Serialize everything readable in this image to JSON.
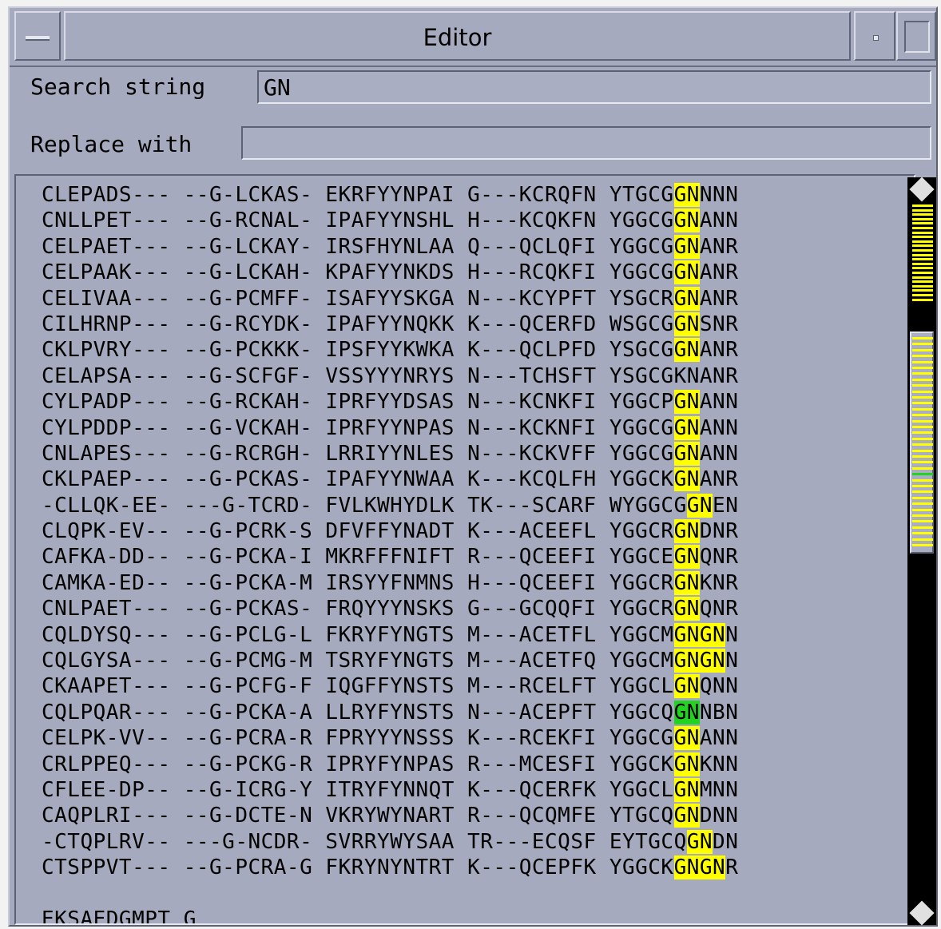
{
  "window": {
    "title": "Editor"
  },
  "search": {
    "label": "Search string",
    "value": "GN"
  },
  "replace": {
    "label": "Replace with",
    "value": ""
  },
  "highlight_colors": {
    "match": "#ffff00",
    "current_match": "#22d322"
  },
  "sequences": [
    {
      "cols": [
        "CLEPADS---",
        "--G-LCKAS-",
        "EKRFYYNPAI",
        "G---KCRQFN"
      ],
      "last": [
        {
          "t": "YTGCG"
        },
        {
          "t": "GN",
          "h": "m"
        },
        {
          "t": "NNN"
        }
      ]
    },
    {
      "cols": [
        "CNLLPET---",
        "--G-RCNAL-",
        "IPAFYYNSHL",
        "H---KCQKFN"
      ],
      "last": [
        {
          "t": "YGGCG"
        },
        {
          "t": "GN",
          "h": "m"
        },
        {
          "t": "ANN"
        }
      ]
    },
    {
      "cols": [
        "CELPAET---",
        "--G-LCKAY-",
        "IRSFHYNLAA",
        "Q---QCLQFI"
      ],
      "last": [
        {
          "t": "YGGCG"
        },
        {
          "t": "GN",
          "h": "m"
        },
        {
          "t": "ANR"
        }
      ]
    },
    {
      "cols": [
        "CELPAAK---",
        "--G-LCKAH-",
        "KPAFYYNKDS",
        "H---RCQKFI"
      ],
      "last": [
        {
          "t": "YGGCG"
        },
        {
          "t": "GN",
          "h": "m"
        },
        {
          "t": "ANR"
        }
      ]
    },
    {
      "cols": [
        "CELIVAA---",
        "--G-PCMFF-",
        "ISAFYYSKGA",
        "N---KCYPFT"
      ],
      "last": [
        {
          "t": "YSGCR"
        },
        {
          "t": "GN",
          "h": "m"
        },
        {
          "t": "ANR"
        }
      ]
    },
    {
      "cols": [
        "CILHRNP---",
        "--G-RCYDK-",
        "IPAFYYNQKK",
        "K---QCERFD"
      ],
      "last": [
        {
          "t": "WSGCG"
        },
        {
          "t": "GN",
          "h": "m"
        },
        {
          "t": "SNR"
        }
      ]
    },
    {
      "cols": [
        "CKLPVRY---",
        "--G-PCKKK-",
        "IPSFYYKWKA",
        "K---QCLPFD"
      ],
      "last": [
        {
          "t": "YSGCG"
        },
        {
          "t": "GN",
          "h": "m"
        },
        {
          "t": "ANR"
        }
      ]
    },
    {
      "cols": [
        "CELAPSA---",
        "--G-SCFGF-",
        "VSSYYYNRYS",
        "N---TCHSFT"
      ],
      "last": [
        {
          "t": "YSGCGKNANR"
        }
      ]
    },
    {
      "cols": [
        "CYLPADP---",
        "--G-RCKAH-",
        "IPRFYYDSAS",
        "N---KCNKFI"
      ],
      "last": [
        {
          "t": "YGGCP"
        },
        {
          "t": "GN",
          "h": "m"
        },
        {
          "t": "ANN"
        }
      ]
    },
    {
      "cols": [
        "CYLPDDP---",
        "--G-VCKAH-",
        "IPRFYYNPAS",
        "N---KCKNFI"
      ],
      "last": [
        {
          "t": "YGGCG"
        },
        {
          "t": "GN",
          "h": "m"
        },
        {
          "t": "ANN"
        }
      ]
    },
    {
      "cols": [
        "CNLAPES---",
        "--G-RCRGH-",
        "LRRIYYNLES",
        "N---KCKVFF"
      ],
      "last": [
        {
          "t": "YGGCG"
        },
        {
          "t": "GN",
          "h": "m"
        },
        {
          "t": "ANN"
        }
      ]
    },
    {
      "cols": [
        "CKLPAEP---",
        "--G-PCKAS-",
        "IPAFYYNWAA",
        "K---KCQLFH"
      ],
      "last": [
        {
          "t": "YGGCK"
        },
        {
          "t": "GN",
          "h": "m"
        },
        {
          "t": "ANR"
        }
      ]
    },
    {
      "cols": [
        "-CLLQK-EE-",
        "---G-TCRD-",
        "FVLKWHYDLK",
        "TK---SCARF"
      ],
      "last": [
        {
          "t": "WYGGCG"
        },
        {
          "t": "GN",
          "h": "m"
        },
        {
          "t": "EN"
        }
      ]
    },
    {
      "cols": [
        "CLQPK-EV--",
        "--G-PCRK-S",
        "DFVFFYNADT",
        "K---ACEEFL"
      ],
      "last": [
        {
          "t": "YGGCR"
        },
        {
          "t": "GN",
          "h": "m"
        },
        {
          "t": "DNR"
        }
      ]
    },
    {
      "cols": [
        "CAFKA-DD--",
        "--G-PCKA-I",
        "MKRFFFNIFT",
        "R---QCEEFI"
      ],
      "last": [
        {
          "t": "YGGCE"
        },
        {
          "t": "GN",
          "h": "m"
        },
        {
          "t": "QNR"
        }
      ]
    },
    {
      "cols": [
        "CAMKA-ED--",
        "--G-PCKA-M",
        "IRSYYFNMNS",
        "H---QCEEFI"
      ],
      "last": [
        {
          "t": "YGGCR"
        },
        {
          "t": "GN",
          "h": "m"
        },
        {
          "t": "KNR"
        }
      ]
    },
    {
      "cols": [
        "CNLPAET---",
        "--G-PCKAS-",
        "FRQYYYNSKS",
        "G---GCQQFI"
      ],
      "last": [
        {
          "t": "YGGCR"
        },
        {
          "t": "GN",
          "h": "m"
        },
        {
          "t": "QNR"
        }
      ]
    },
    {
      "cols": [
        "CQLDYSQ---",
        "--G-PCLG-L",
        "FKRYFYNGTS",
        "M---ACETFL"
      ],
      "last": [
        {
          "t": "YGGCM"
        },
        {
          "t": "GNGN",
          "h": "m"
        },
        {
          "t": "N"
        }
      ]
    },
    {
      "cols": [
        "CQLGYSA---",
        "--G-PCMG-M",
        "TSRYFYNGTS",
        "M---ACETFQ"
      ],
      "last": [
        {
          "t": "YGGCM"
        },
        {
          "t": "GNGN",
          "h": "m"
        },
        {
          "t": "N"
        }
      ]
    },
    {
      "cols": [
        "CKAAPET---",
        "--G-PCFG-F",
        "IQGFFYNSTS",
        "M---RCELFT"
      ],
      "last": [
        {
          "t": "YGGCL"
        },
        {
          "t": "GN",
          "h": "m"
        },
        {
          "t": "QNN"
        }
      ]
    },
    {
      "cols": [
        "CQLPQAR---",
        "--G-PCKA-A",
        "LLRYFYNSTS",
        "N---ACEPFT"
      ],
      "last": [
        {
          "t": "YGGCQ"
        },
        {
          "t": "GN",
          "h": "c"
        },
        {
          "t": "NBN"
        }
      ]
    },
    {
      "cols": [
        "CELPK-VV--",
        "--G-PCRA-R",
        "FPRYYYNSSS",
        "K---RCEKFI"
      ],
      "last": [
        {
          "t": "YGGCG"
        },
        {
          "t": "GN",
          "h": "m"
        },
        {
          "t": "ANN"
        }
      ]
    },
    {
      "cols": [
        "CRLPPEQ---",
        "--G-PCKG-R",
        "IPRYFYNPAS",
        "R---MCESFI"
      ],
      "last": [
        {
          "t": "YGGCK"
        },
        {
          "t": "GN",
          "h": "m"
        },
        {
          "t": "KNN"
        }
      ]
    },
    {
      "cols": [
        "CFLEE-DP--",
        "--G-ICRG-Y",
        "ITRYFYNNQT",
        "K---QCERFK"
      ],
      "last": [
        {
          "t": "YGGCL"
        },
        {
          "t": "GN",
          "h": "m"
        },
        {
          "t": "MNN"
        }
      ]
    },
    {
      "cols": [
        "CAQPLRI---",
        "--G-DCTE-N",
        "VKRYWYNART",
        "R---QCQMFE"
      ],
      "last": [
        {
          "t": "YTGCQ"
        },
        {
          "t": "GN",
          "h": "m"
        },
        {
          "t": "DNN"
        }
      ]
    },
    {
      "cols": [
        "-CTQPLRV--",
        "---G-NCDR-",
        "SVRRYWYSAA",
        "TR---ECQSF"
      ],
      "last": [
        {
          "t": "EYTGCQ"
        },
        {
          "t": "GN",
          "h": "m"
        },
        {
          "t": "DN"
        }
      ]
    },
    {
      "cols": [
        "CTSPPVT---",
        "--G-PCRA-G",
        "FKRYNYNTRT",
        "K---QCEPFK"
      ],
      "last": [
        {
          "t": "YGGCK"
        },
        {
          "t": "GNGN",
          "h": "m"
        },
        {
          "t": "R"
        }
      ]
    },
    {
      "cols": [
        "",
        "",
        "",
        ""
      ],
      "last": []
    },
    {
      "cols": [
        "EKSAEDGMPT",
        "G",
        "",
        ""
      ],
      "last": []
    }
  ]
}
